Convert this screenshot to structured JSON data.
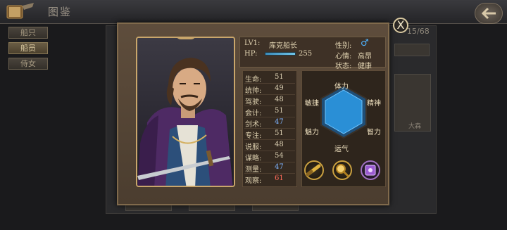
{
  "header": {
    "title": "图鉴"
  },
  "side_tabs": [
    {
      "label": "船只",
      "active": false
    },
    {
      "label": "船员",
      "active": true
    },
    {
      "label": "侍女",
      "active": false
    }
  ],
  "background": {
    "counter": "15/68",
    "card_label": "大森"
  },
  "character": {
    "level": "LV1:",
    "name": "库克船长",
    "gender_label": "性别:",
    "gender_icon": "male-icon",
    "hp_label": "HP:",
    "hp_value": "255",
    "mood_label": "心情:",
    "mood_value": "高昂",
    "state_label": "状态:",
    "state_value": "健康"
  },
  "stats": [
    {
      "label": "生命:",
      "value": "51",
      "color": "normal"
    },
    {
      "label": "统帅:",
      "value": "49",
      "color": "normal"
    },
    {
      "label": "驾驶:",
      "value": "48",
      "color": "normal"
    },
    {
      "label": "会计:",
      "value": "51",
      "color": "normal"
    },
    {
      "label": "剑术:",
      "value": "47",
      "color": "blue"
    },
    {
      "label": "专注:",
      "value": "51",
      "color": "normal"
    },
    {
      "label": "说服:",
      "value": "48",
      "color": "normal"
    },
    {
      "label": "谋略:",
      "value": "54",
      "color": "normal"
    },
    {
      "label": "测量:",
      "value": "47",
      "color": "blue"
    },
    {
      "label": "观察:",
      "value": "61",
      "color": "red"
    }
  ],
  "radar": {
    "top": "体力",
    "upper_right": "精神",
    "lower_right": "智力",
    "bottom": "运气",
    "lower_left": "魅力",
    "upper_left": "敏捷",
    "fill_color": "#2a8fd6"
  },
  "actions": [
    {
      "icon": "spyglass-icon"
    },
    {
      "icon": "magnifier-icon"
    },
    {
      "icon": "spellbook-icon"
    }
  ],
  "close_label": "X",
  "colors": {
    "accent": "#c9a66b",
    "panel": "#4b3d2f",
    "blue_value": "#7fb4ff",
    "red_value": "#ff6b5a"
  }
}
